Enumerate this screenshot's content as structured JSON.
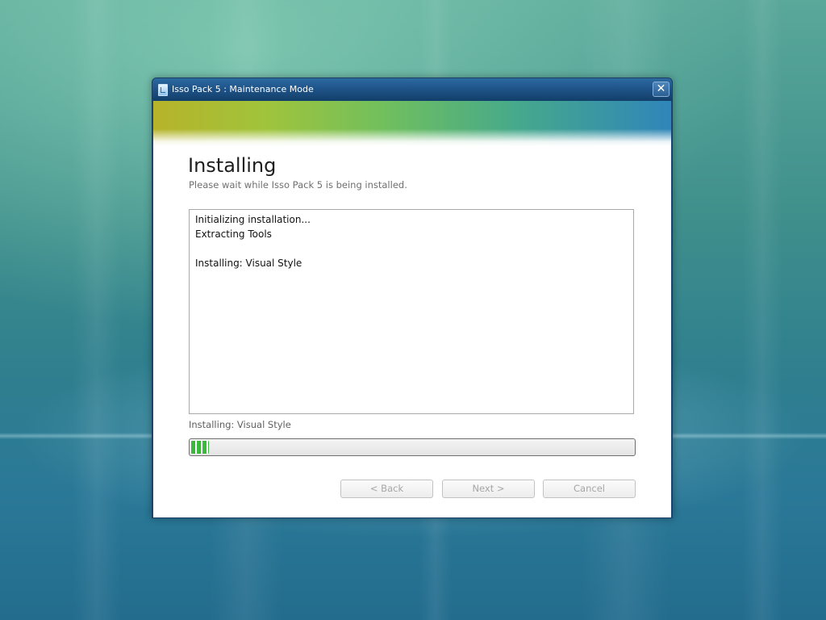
{
  "window": {
    "title": "Isso Pack 5 : Maintenance Mode",
    "close_glyph": "✕"
  },
  "page": {
    "heading": "Installing",
    "subheading": "Please wait while Isso Pack 5 is being installed."
  },
  "log": {
    "lines": [
      "Initializing installation...",
      "Extracting Tools",
      "",
      "Installing: Visual Style"
    ]
  },
  "status": {
    "text": "Installing: Visual Style"
  },
  "progress": {
    "percent": 4
  },
  "buttons": {
    "back": "< Back",
    "next": "Next >",
    "cancel": "Cancel"
  },
  "icons": {
    "app": "installer-app-icon",
    "close": "close-icon"
  },
  "colors": {
    "progress_fill": "#3fbf3f",
    "titlebar": "#1e5286"
  }
}
